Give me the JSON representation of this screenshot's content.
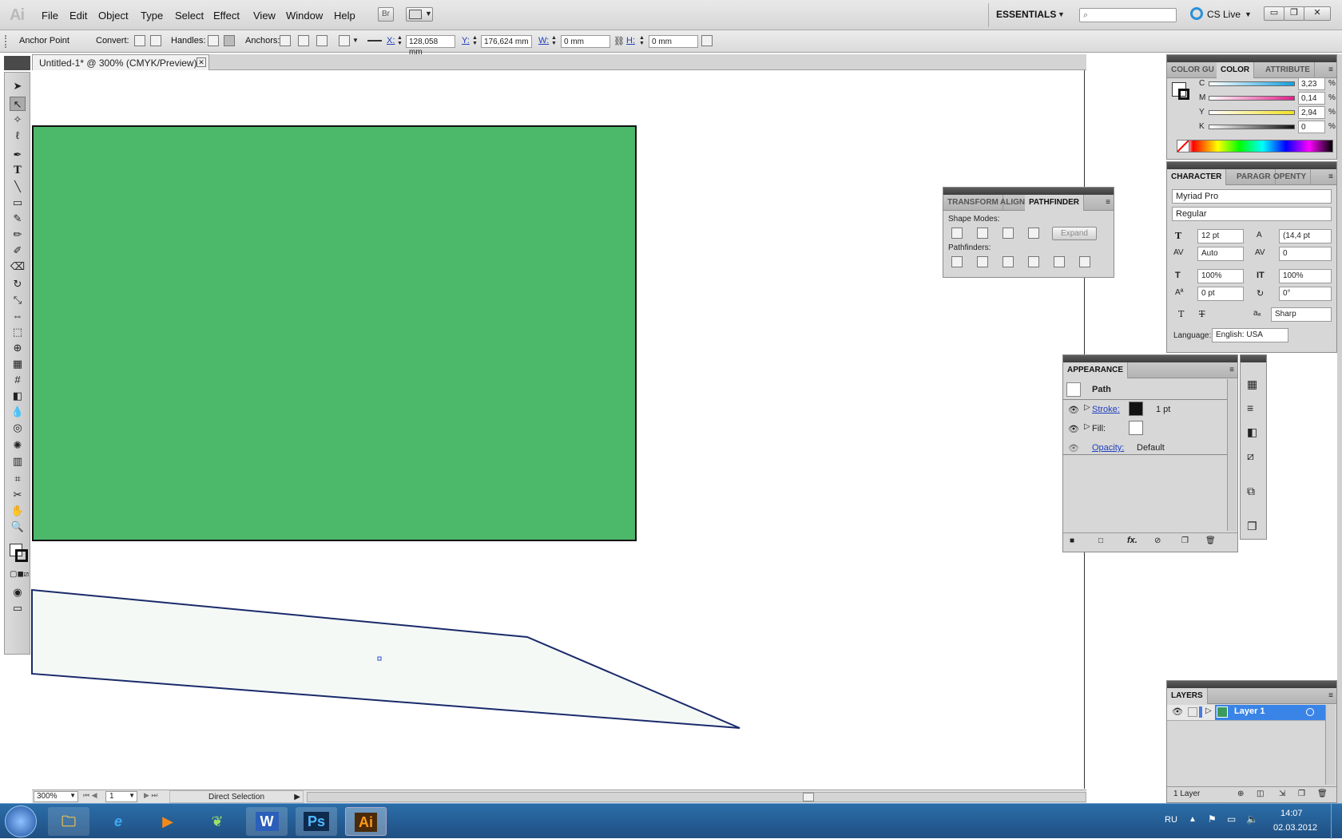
{
  "menubar": {
    "logo": "Ai",
    "items": [
      "File",
      "Edit",
      "Object",
      "Type",
      "Select",
      "Effect",
      "View",
      "Window",
      "Help"
    ],
    "bridge": "Br",
    "workspace": "ESSENTIALS",
    "cslive": "CS Live"
  },
  "control": {
    "tool_name": "Anchor Point",
    "convert": "Convert:",
    "handles": "Handles:",
    "anchors": "Anchors:",
    "x_label": "X:",
    "x": "128,058 mm",
    "y_label": "Y:",
    "y": "176,624 mm",
    "w_label": "W:",
    "w": "0 mm",
    "h_label": "H:",
    "h": "0 mm"
  },
  "document": {
    "tab_title": "Untitled-1* @ 300% (CMYK/Preview)"
  },
  "colors": {
    "green_rect": "#4cb86a",
    "shape_fill": "#f4f9f6",
    "path_stroke": "#1a2a6a"
  },
  "color_panel": {
    "tabs": [
      "COLOR GU",
      "COLOR",
      "ATTRIBUTE"
    ],
    "channels": [
      {
        "label": "C",
        "value": "3,23",
        "unit": "%",
        "color": "#12a0e0"
      },
      {
        "label": "M",
        "value": "0,14",
        "unit": "%",
        "color": "#e0208a"
      },
      {
        "label": "Y",
        "value": "2,94",
        "unit": "%",
        "color": "#f2e020"
      },
      {
        "label": "K",
        "value": "0",
        "unit": "%",
        "color": "#111111"
      }
    ]
  },
  "character_panel": {
    "tabs": [
      "CHARACTER",
      "PARAGR",
      "OPENTY"
    ],
    "font": "Myriad Pro",
    "style": "Regular",
    "size": "12 pt",
    "leading": "(14,4 pt",
    "kerning": "Auto",
    "tracking": "0",
    "vscale": "100%",
    "hscale": "100%",
    "baseline": "0 pt",
    "rotation": "0°",
    "antialias": "Sharp",
    "language_label": "Language:",
    "language": "English: USA"
  },
  "pathfinder_panel": {
    "tabs": [
      "TRANSFORM",
      "ALIGN",
      "PATHFINDER"
    ],
    "shape_modes": "Shape Modes:",
    "expand": "Expand",
    "pathfinders": "Pathfinders:"
  },
  "appearance_panel": {
    "title": "APPEARANCE",
    "object": "Path",
    "stroke_label": "Stroke:",
    "stroke_weight": "1 pt",
    "fill_label": "Fill:",
    "opacity_label": "Opacity:",
    "opacity_value": "Default"
  },
  "layers_panel": {
    "title": "LAYERS",
    "layer": "Layer 1",
    "count": "1 Layer"
  },
  "status": {
    "zoom": "300%",
    "page": "1",
    "tool": "Direct Selection"
  },
  "taskbar": {
    "lang": "RU",
    "time": "14:07",
    "date": "02.03.2012",
    "apps": [
      "Explorer",
      "Internet Explorer",
      "Media Player",
      "Dreamweaver",
      "Word",
      "Photoshop",
      "Illustrator"
    ],
    "ps": "Ps",
    "ai": "Ai",
    "word": "W"
  }
}
